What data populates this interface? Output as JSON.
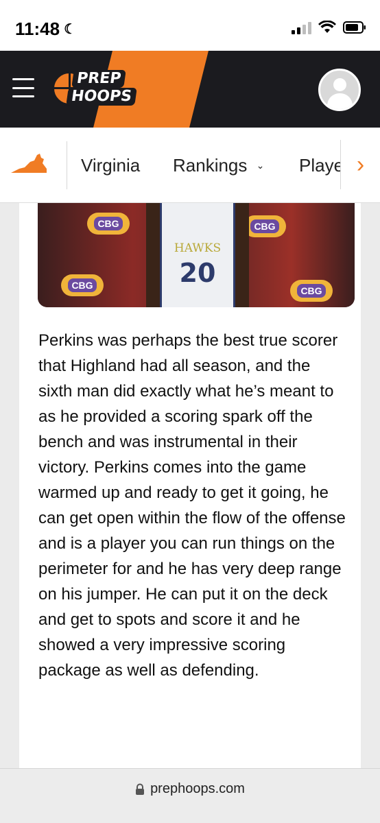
{
  "status_bar": {
    "time": "11:48",
    "moon_icon": "moon-icon",
    "signal_icon": "cellular-signal-icon",
    "wifi_icon": "wifi-icon",
    "battery_icon": "battery-icon"
  },
  "header": {
    "menu_icon": "hamburger-menu-icon",
    "logo": {
      "line1": "PREP",
      "line2": "HOOPS"
    },
    "profile_icon": "user-avatar-icon",
    "colors": {
      "background": "#1b1b1f",
      "accent": "#f07c24"
    }
  },
  "nav": {
    "state_icon": "virginia-state-icon",
    "items": [
      {
        "label": "Virginia"
      },
      {
        "label": "Rankings",
        "dropdown": true
      },
      {
        "label": "Playe"
      }
    ],
    "next_icon": "chevron-right-icon"
  },
  "article": {
    "photo": {
      "jersey_team": "HAWKS",
      "jersey_number": "20",
      "backdrop_logo": "CBG"
    },
    "paragraph": "Perkins was perhaps the best true scorer that Highland had all season, and the sixth man did exactly what he’s meant to as he provided a scoring spark off the bench and was instrumental in their victory. Perkins comes into the game warmed up and ready to get it going, he can get open within the flow of the offense and is a player you can run things on the perimeter for and he has very deep range on his jumper. He can put it on the deck and get to spots and score it and he showed a very impressive scoring package as well as defending."
  },
  "browser": {
    "lock_icon": "lock-icon",
    "url": "prephoops.com"
  }
}
